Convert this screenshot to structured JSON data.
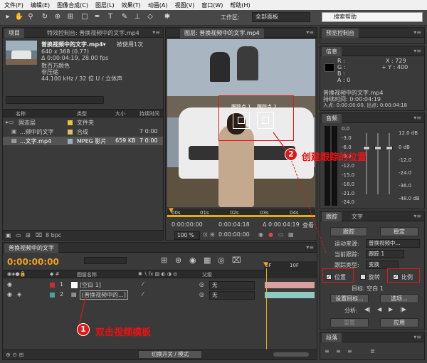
{
  "menu": [
    "文件(F)",
    "编辑(E)",
    "图像合成(C)",
    "图层(L)",
    "效果(T)",
    "动画(A)",
    "视图(V)",
    "窗口(W)",
    "帮助(H)"
  ],
  "workspace": {
    "label": "工作区:",
    "value": "全部面板"
  },
  "search": {
    "placeholder": "搜索帮助"
  },
  "project": {
    "tabs": [
      "项目",
      "特效控制台: 普换视频中的文字.mp4"
    ],
    "file_name": "普换视频中的文字.mp4▾",
    "used": "被使用1次",
    "line1": "640 x 368 (0.77)",
    "line2": "Δ 0:00:04:19, 28.00 fps",
    "line3": "数百万颜色",
    "line4": "非压缩",
    "line5": "44.100 kHz / 32 位 U / 立体声",
    "columns": [
      "名称",
      "类型",
      "大小",
      "持续时间"
    ],
    "items": [
      {
        "name": "固态层",
        "type": "文件夹",
        "size": "",
        "dur": "",
        "color": "#e8c23a"
      },
      {
        "name": "...频中的文字",
        "type": "合成",
        "size": "",
        "dur": "7 0:00",
        "color": "#e0c060"
      },
      {
        "name": "...文字.mp4",
        "type": "MPEG 影片",
        "size": "659 KB",
        "dur": "7 0:00",
        "color": "#9ab0c4"
      }
    ],
    "bpc": "8 bpc"
  },
  "viewer": {
    "tab": "图层: 普换视频中的文字.mp4",
    "track1": "跟踪点 1",
    "track2": "跟踪点 2",
    "ruler": [
      "00s",
      "01s",
      "02s",
      "03s",
      "04s"
    ],
    "t_start": "0:00:00:00",
    "t_end": "0:00:04:18",
    "t_dur": "Δ 0:00:04:19",
    "view_label": "查看",
    "zoom": "100 %",
    "time_cur": "0:00:00:00"
  },
  "preview": {
    "tab": "预览控制台"
  },
  "info": {
    "tab": "信息",
    "r": "R :",
    "g": "G :",
    "b": "B :",
    "a": "A : 0",
    "x": "X : 729",
    "y": "+ Y : 400",
    "name": "普换视频中的文字.mp4",
    "dur": "持续时间: 0:00:04:19",
    "inout": "入点: 0:00:00:00, 出点: 0:00:04:18"
  },
  "audio": {
    "tab": "音频",
    "left": [
      "0.0",
      "-3.0",
      "-6.0",
      "-9.0",
      "-12.0",
      "-15.0",
      "-18.0",
      "-21.0",
      "-24.0"
    ],
    "right": [
      "12.0 dB",
      "0 dB",
      "-12.0",
      "-24.0",
      "-36.0",
      "-48.0 dB"
    ]
  },
  "tracker": {
    "tabs": [
      "跟踪",
      "文字"
    ],
    "track_btn": "跟踪",
    "stabilize_btn": "稳定",
    "motion_src_label": "运动来源:",
    "motion_src": "普换视频中...",
    "current_label": "当前跟踪:",
    "current": "跟踪 1",
    "type_label": "跟踪类型:",
    "type": "变换",
    "position": "位置",
    "rotation": "旋转",
    "scale": "比例",
    "target": "目标: 空白 1",
    "set_target": "设置目标...",
    "options": "选项...",
    "analyze": "分析:",
    "reset": "重置",
    "apply": "应用"
  },
  "paragraph": {
    "tab": "段落"
  },
  "timeline": {
    "tab": "普换视频中的文字",
    "time": "0:00:00:00",
    "col_name": "图层名称",
    "col_parent": "父级",
    "ruler": [
      "0F",
      "10F"
    ],
    "layers": [
      {
        "num": "1",
        "name": "[空白 1]",
        "parent": "无",
        "color": "#c83030"
      },
      {
        "num": "2",
        "name": "[普换视频中的...]",
        "parent": "无",
        "color": "#4aa0a0"
      }
    ],
    "switch_label": "切换开关 / 模式"
  },
  "annotations": {
    "a1": "双击视频模板",
    "a2": "创建跟踪的位置",
    "n1": "1",
    "n2": "2"
  },
  "colors": {
    "accent": "#f0a020",
    "annotation": "#e01818",
    "selected_row": "#bccfdc"
  }
}
